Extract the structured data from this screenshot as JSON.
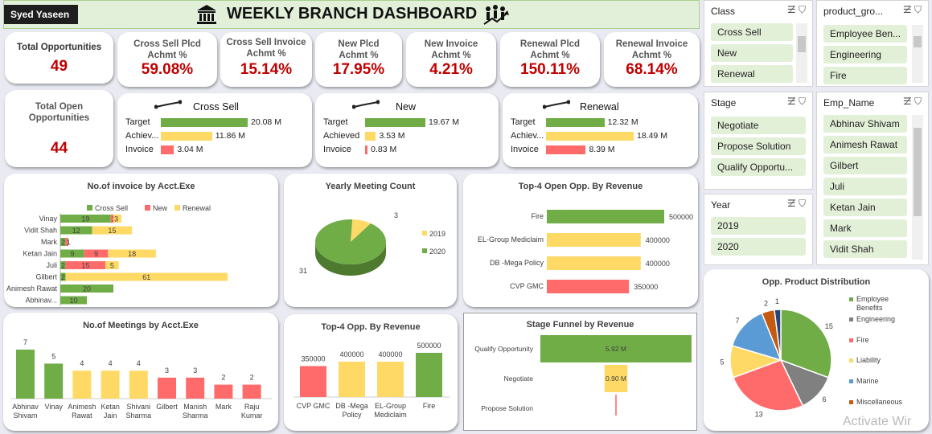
{
  "header": {
    "user": "Syed Yaseen",
    "title": "WEEKLY BRANCH DASHBOARD"
  },
  "kpis": {
    "total_opps": {
      "label": "Total Opportunities",
      "value": "49"
    },
    "cross_sell_plcd": {
      "label": "Cross Sell Plcd Achmt %",
      "value": "59.08%"
    },
    "cross_sell_inv": {
      "label": "Cross Sell Invoice Achmt %",
      "value": "15.14%"
    },
    "new_plcd": {
      "label": "New Plcd Achmt %",
      "value": "17.95%"
    },
    "new_inv": {
      "label": "New Invoice Achmt %",
      "value": "4.21%"
    },
    "renewal_plcd": {
      "label": "Renewal Plcd Achmt %",
      "value": "150.11%"
    },
    "renewal_inv": {
      "label": "Renewal Invoice Achmt %",
      "value": "68.14%"
    },
    "total_open": {
      "label": "Total Open Opportunities",
      "value": "44"
    }
  },
  "mini_charts": [
    {
      "title": "Cross Sell",
      "rows": [
        {
          "label": "Target",
          "value": 20.08,
          "text": "20.08 M",
          "color": "#70ad47"
        },
        {
          "label": "Achiev...",
          "value": 11.86,
          "text": "11.86 M",
          "color": "#ffd966"
        },
        {
          "label": "Invoice",
          "value": 3.04,
          "text": "3.04 M",
          "color": "#ff6b6b"
        }
      ]
    },
    {
      "title": "New",
      "rows": [
        {
          "label": "Target",
          "value": 19.67,
          "text": "19.67 M",
          "color": "#70ad47"
        },
        {
          "label": "Achieved",
          "value": 3.53,
          "text": "3.53 M",
          "color": "#ffd966"
        },
        {
          "label": "Invoice",
          "value": 0.83,
          "text": "0.83 M",
          "color": "#ff6b6b"
        }
      ]
    },
    {
      "title": "Renewal",
      "rows": [
        {
          "label": "Target",
          "value": 12.32,
          "text": "12.32 M",
          "color": "#70ad47"
        },
        {
          "label": "Achiev...",
          "value": 18.49,
          "text": "18.49 M",
          "color": "#ffd966"
        },
        {
          "label": "Invoice",
          "value": 8.39,
          "text": "8.39 M",
          "color": "#ff6b6b"
        }
      ]
    }
  ],
  "chart_data": [
    {
      "type": "bar",
      "title": "No.of invoice by Acct.Exe",
      "orientation": "horizontal",
      "stacked": true,
      "categories": [
        "Vinay",
        "Vidit Shah",
        "Mark",
        "Ketan Jain",
        "Juli",
        "Gilbert",
        "Animesh Rawat",
        "Abhinav..."
      ],
      "series": [
        {
          "name": "Cross Sell",
          "color": "#70ad47",
          "values": [
            19,
            12,
            2,
            9,
            2,
            2,
            20,
            10
          ]
        },
        {
          "name": "New",
          "color": "#ff6b6b",
          "values": [
            1,
            0,
            1,
            9,
            15,
            0,
            0,
            0
          ]
        },
        {
          "name": "Renewal",
          "color": "#ffd966",
          "values": [
            3,
            15,
            0,
            18,
            5,
            61,
            0,
            0
          ]
        }
      ],
      "legend": "top"
    },
    {
      "type": "pie",
      "title": "Yearly Meeting Count",
      "slices": [
        {
          "label": "2019",
          "value": 3,
          "color": "#ffd966"
        },
        {
          "label": "2020",
          "value": 31,
          "color": "#70ad47"
        }
      ],
      "legend": "right"
    },
    {
      "type": "bar",
      "title": "Top-4 Open Opp. By Revenue",
      "orientation": "horizontal",
      "categories": [
        "Fire",
        "EL-Group Mediclaim",
        "DB -Mega Policy",
        "CVP GMC"
      ],
      "values": [
        500000,
        400000,
        400000,
        350000
      ],
      "colors": [
        "#70ad47",
        "#ffd966",
        "#ffd966",
        "#ff6b6b"
      ]
    },
    {
      "type": "bar",
      "title": "No.of Meetings by Acct.Exe",
      "categories": [
        "Abhinav Shivam",
        "Vinay",
        "Animesh Rawat",
        "Ketan Jain",
        "Shivani Sharma",
        "Gilbert",
        "Manish Sharma",
        "Mark",
        "Raju Kumar"
      ],
      "values": [
        7,
        5,
        4,
        4,
        4,
        3,
        3,
        2,
        2
      ],
      "colors": [
        "#70ad47",
        "#70ad47",
        "#ffd966",
        "#ffd966",
        "#ffd966",
        "#ff6b6b",
        "#ff6b6b",
        "#ff6b6b",
        "#ff6b6b"
      ]
    },
    {
      "type": "bar",
      "title": "Top-4 Opp. By Revenue",
      "categories": [
        "CVP GMC",
        "DB -Mega Policy",
        "EL-Group Mediclaim",
        "Fire"
      ],
      "values": [
        350000,
        400000,
        400000,
        500000
      ],
      "colors": [
        "#ff6b6b",
        "#ffd966",
        "#ffd966",
        "#70ad47"
      ]
    },
    {
      "type": "bar",
      "title": "Stage Funnel by Revenue",
      "orientation": "funnel",
      "categories": [
        "Qualify Opportunity",
        "Negotiate",
        "Propose Solution"
      ],
      "values": [
        5.92,
        0.9,
        0.05
      ],
      "labels": [
        "5.92 M",
        "0.90 M",
        ""
      ],
      "colors": [
        "#70ad47",
        "#ffd966",
        "#ff6b6b"
      ]
    },
    {
      "type": "pie",
      "title": "Opp. Product Distribution",
      "slices": [
        {
          "label": "Employee Benefits",
          "value": 15,
          "color": "#70ad47"
        },
        {
          "label": "Engineering",
          "value": 6,
          "color": "#808080"
        },
        {
          "label": "Fire",
          "value": 13,
          "color": "#ff6b6b"
        },
        {
          "label": "Liability",
          "value": 5,
          "color": "#ffd966"
        },
        {
          "label": "Marine",
          "value": 7,
          "color": "#5b9bd5"
        },
        {
          "label": "Miscellaneous",
          "value": 2,
          "color": "#c55a11"
        },
        {
          "label": "",
          "value": 1,
          "color": "#264478"
        }
      ],
      "legend": "right"
    }
  ],
  "slicers": {
    "class": {
      "title": "Class",
      "items": [
        "Cross Sell",
        "New",
        "Renewal"
      ]
    },
    "product": {
      "title": "product_gro...",
      "items": [
        "Employee Ben...",
        "Engineering",
        "Fire"
      ]
    },
    "stage": {
      "title": "Stage",
      "items": [
        "Negotiate",
        "Propose Solution",
        "Qualify Opportu..."
      ]
    },
    "emp": {
      "title": "Emp_Name",
      "items": [
        "Abhinav Shivam",
        "Animesh Rawat",
        "Gilbert",
        "Juli",
        "Ketan Jain",
        "Mark",
        "Vidit Shah"
      ]
    },
    "year": {
      "title": "Year",
      "items": [
        "2019",
        "2020"
      ]
    }
  },
  "watermark": "Activate Wir"
}
